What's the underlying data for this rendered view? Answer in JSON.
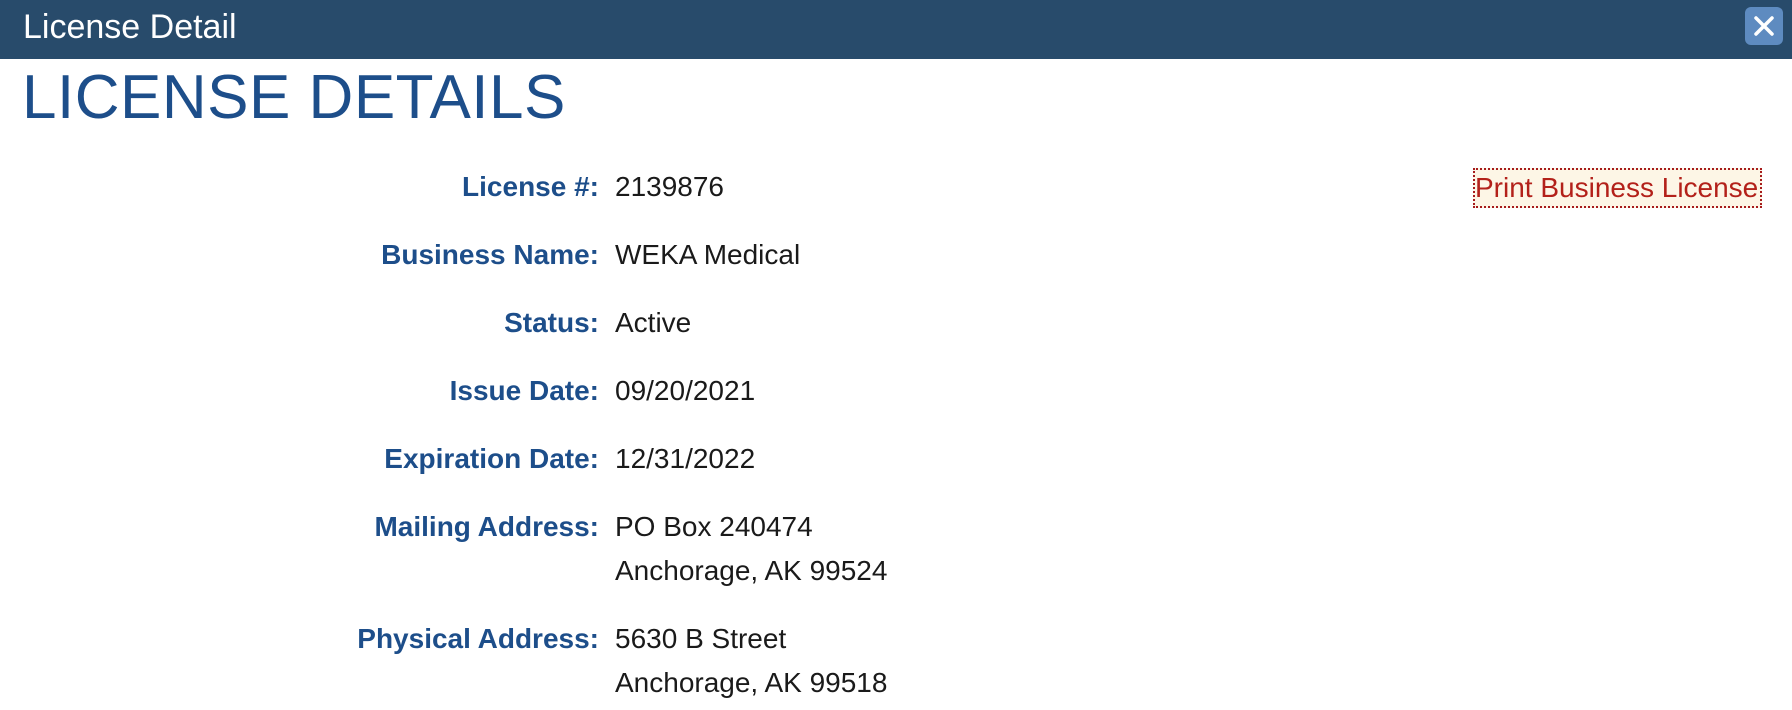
{
  "window": {
    "title": "License Detail",
    "close_icon": "close-icon"
  },
  "page": {
    "heading": "LICENSE DETAILS",
    "print_link": "Print Business License"
  },
  "fields": [
    {
      "label": "License #:",
      "value_lines": [
        "2139876"
      ]
    },
    {
      "label": "Business Name:",
      "value_lines": [
        "WEKA Medical"
      ]
    },
    {
      "label": "Status:",
      "value_lines": [
        "Active"
      ]
    },
    {
      "label": "Issue Date:",
      "value_lines": [
        "09/20/2021"
      ]
    },
    {
      "label": "Expiration Date:",
      "value_lines": [
        "12/31/2022"
      ]
    },
    {
      "label": "Mailing Address:",
      "value_lines": [
        "PO Box 240474",
        "Anchorage, AK 99524"
      ]
    },
    {
      "label": "Physical Address:",
      "value_lines": [
        "5630 B Street",
        "Anchorage, AK 99518"
      ]
    }
  ],
  "colors": {
    "titlebar": "#284b6b",
    "label": "#1d4e8a",
    "link": "#b3211a"
  }
}
